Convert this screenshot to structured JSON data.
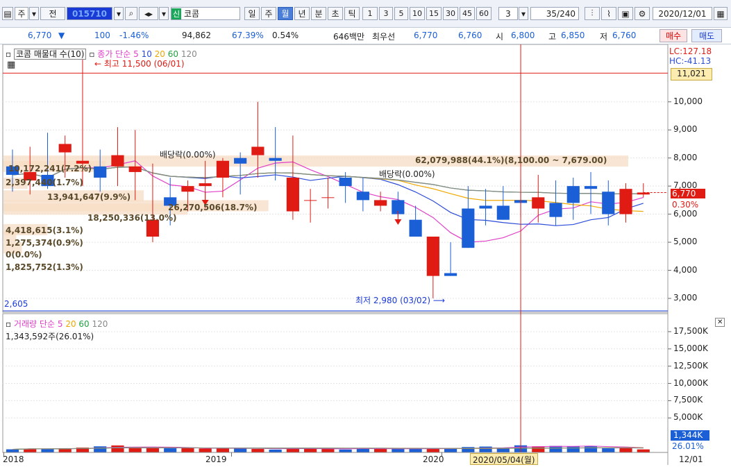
{
  "toolbar": {
    "period_jong": "주",
    "jeon": "전",
    "code": "015710",
    "credit_tag": "신",
    "name": "코콤",
    "periods": [
      "일",
      "주",
      "월",
      "년",
      "분",
      "초",
      "틱"
    ],
    "selected_period": "월",
    "intervals": [
      "1",
      "3",
      "5",
      "10",
      "15",
      "30",
      "45",
      "60"
    ],
    "unit_value": "3",
    "count": "35",
    "count_total": "/240",
    "date": "2020/12/01"
  },
  "quote": {
    "price": "6,770",
    "change": "100",
    "change_pct": "-1.46%",
    "volume": "94,862",
    "vol_ratio": "67.39%",
    "turnover": "0.54%",
    "amount": "646백만",
    "best_label": "최우선",
    "ask": "6,770",
    "bid": "6,760",
    "open_label": "시",
    "open": "6,800",
    "high_label": "고",
    "high": "6,850",
    "low_label": "저",
    "low": "6,760",
    "buy_label": "매수",
    "sell_label": "매도"
  },
  "price_panel": {
    "title": "코콤 매물대 수(10)",
    "ma_label": "종가 단순",
    "ma_periods": [
      "5",
      "10",
      "20",
      "60",
      "120"
    ],
    "max_note": "최고 11,500 (06/01)",
    "min_note": "최저 2,980 (03/02)",
    "dividend1": "배당락(0.00%)",
    "dividend2": "배당락(0.00%)",
    "lc": "LC:127.18",
    "hc": "HC:-41.13",
    "hline_value": "11,021",
    "last_price": "6,770",
    "last_pct": "0.30%",
    "bottom_left": "2,605",
    "volume_profile": [
      {
        "label": "10,172,241(7.2%)"
      },
      {
        "label": "2,397,440(1.7%)"
      },
      {
        "label": "13,941,647(9.9%)"
      },
      {
        "label": "18,250,336(13.0%)"
      },
      {
        "label": "26,270,506(18.7%)"
      },
      {
        "label": "62,079,988(44.1%)(8,100.00 ~ 7,679.00)"
      },
      {
        "label": "4,418,615(3.1%)"
      },
      {
        "label": "1,275,374(0.9%)"
      },
      {
        "label": "0(0.0%)"
      },
      {
        "label": "1,825,752(1.3%)"
      }
    ],
    "y_ticks": [
      "10,000",
      "9,000",
      "8,000",
      "7,000",
      "6,000",
      "5,000",
      "4,000",
      "3,000"
    ]
  },
  "volume_panel": {
    "title": "거래량",
    "ma_label": "단순",
    "ma_periods": [
      "5",
      "20",
      "60",
      "120"
    ],
    "current": "1,343,592주(26.01%)",
    "last_value": "1,344K",
    "last_pct": "26.01%",
    "y_ticks": [
      "17,500K",
      "15,000K",
      "12,500K",
      "10,000K",
      "7,500K",
      "5,000K"
    ]
  },
  "x_axis": {
    "labels": [
      "2018",
      "2019",
      "2020"
    ],
    "cursor_date": "2020/05/04(월)",
    "right_label": "12/01"
  },
  "colors": {
    "up": "#e01b14",
    "down": "#1a5fd6",
    "ma5": "#e040c8",
    "ma10": "#2a4ad8",
    "ma20": "#f0a800",
    "ma60": "#20a040",
    "ma120": "#888888",
    "profile": "#f7dcc4"
  },
  "chart_data": {
    "type": "candlestick",
    "x": [
      "2017/12",
      "2018/01",
      "2018/02",
      "2018/03",
      "2018/04",
      "2018/05",
      "2018/06",
      "2018/07",
      "2018/08",
      "2018/09",
      "2018/10",
      "2018/11",
      "2018/12",
      "2019/01",
      "2019/02",
      "2019/03",
      "2019/04",
      "2019/05",
      "2019/06",
      "2019/07",
      "2019/08",
      "2019/09",
      "2019/10",
      "2019/11",
      "2019/12",
      "2020/01",
      "2020/02",
      "2020/03",
      "2020/04",
      "2020/05",
      "2020/06",
      "2020/07",
      "2020/08",
      "2020/09",
      "2020/10",
      "2020/11",
      "2020/12"
    ],
    "open": [
      7700,
      7200,
      7400,
      8200,
      7800,
      7700,
      7700,
      7500,
      5200,
      6600,
      6800,
      7000,
      7300,
      8000,
      8100,
      8000,
      6100,
      6500,
      6600,
      7300,
      6800,
      6300,
      6500,
      5800,
      3800,
      3900,
      6200,
      6300,
      6300,
      6500,
      6200,
      6400,
      7000,
      7000,
      6800,
      6000,
      6700
    ],
    "high": [
      8300,
      8400,
      8900,
      8800,
      11500,
      8300,
      9100,
      9000,
      7800,
      7300,
      7200,
      7900,
      8000,
      8200,
      10000,
      9100,
      8800,
      6900,
      7300,
      7500,
      7300,
      6800,
      6800,
      6300,
      5100,
      5000,
      7000,
      6900,
      7000,
      7200,
      7400,
      7200,
      7300,
      7500,
      7200,
      7100,
      7100
    ],
    "low": [
      6800,
      6700,
      6900,
      7300,
      7000,
      6800,
      7000,
      6500,
      5000,
      5600,
      6100,
      6200,
      6600,
      6700,
      7300,
      7200,
      5800,
      5700,
      6200,
      6400,
      6100,
      6100,
      5900,
      5200,
      3000,
      3800,
      4800,
      5600,
      5800,
      5900,
      5700,
      5600,
      5800,
      6000,
      5600,
      5700,
      6600
    ],
    "close": [
      7400,
      7500,
      7000,
      8500,
      7900,
      7300,
      8100,
      7700,
      5800,
      6300,
      7000,
      7100,
      7900,
      7800,
      8400,
      7900,
      7300,
      6500,
      6600,
      7000,
      6500,
      6500,
      6000,
      5200,
      5200,
      3800,
      4800,
      6200,
      5800,
      6400,
      6600,
      5900,
      6400,
      6900,
      6000,
      6900,
      6770
    ],
    "volume": [
      450,
      560,
      520,
      610,
      700,
      880,
      1010,
      640,
      690,
      600,
      610,
      570,
      550,
      680,
      500,
      410,
      600,
      570,
      580,
      420,
      600,
      550,
      530,
      570,
      500,
      550,
      780,
      850,
      650,
      1030,
      880,
      940,
      870,
      930,
      590,
      610,
      440
    ],
    "ylim": [
      2605,
      11600
    ],
    "volume_ylim": [
      0,
      18500
    ]
  }
}
